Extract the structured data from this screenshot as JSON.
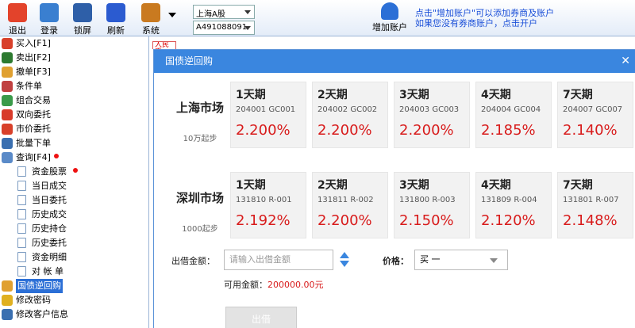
{
  "toolbar": {
    "buttons": [
      {
        "label": "退出",
        "icon": "power-icon",
        "color": "#e3432b"
      },
      {
        "label": "登录",
        "icon": "users-icon",
        "color": "#3a7fd0"
      },
      {
        "label": "锁屏",
        "icon": "grid-lock-icon",
        "color": "#2e5fa8"
      },
      {
        "label": "刷新",
        "icon": "refresh-icon",
        "color": "#2b5bd0"
      },
      {
        "label": "系统",
        "icon": "tools-icon",
        "color": "#c97a20"
      }
    ],
    "market_select": "上海A股",
    "account_select": "A491088091",
    "add_account_label": "增加账户",
    "tip_line1": "点击\"增加账户\"可以添加券商及账户",
    "tip_line2": "如果您没有券商账户，点击开户"
  },
  "sidebar": {
    "items": [
      {
        "label": "买入[F1]",
        "icon": "buy-icon",
        "color": "#d8402a",
        "sub": false
      },
      {
        "label": "卖出[F2]",
        "icon": "sell-icon",
        "color": "#2d7a30",
        "sub": false
      },
      {
        "label": "撤单[F3]",
        "icon": "cancel-hand-icon",
        "color": "#e0a030",
        "sub": false
      },
      {
        "label": "条件单",
        "icon": "condition-icon",
        "color": "#c04040",
        "sub": false
      },
      {
        "label": "组合交易",
        "icon": "globe-icon",
        "color": "#3a9a4a",
        "sub": false
      },
      {
        "label": "双向委托",
        "icon": "two-way-icon",
        "color": "#d83a2a",
        "sub": false
      },
      {
        "label": "市价委托",
        "icon": "market-icon",
        "color": "#d8402a",
        "sub": false
      },
      {
        "label": "批量下单",
        "icon": "batch-icon",
        "color": "#3a6fb0",
        "sub": false
      },
      {
        "label": "查询[F4]",
        "icon": "query-icon",
        "color": "#5a8ac8",
        "sub": false,
        "dot": true
      },
      {
        "label": "资金股票",
        "icon": "doc-icon",
        "sub": true,
        "dot": true
      },
      {
        "label": "当日成交",
        "icon": "doc-icon",
        "sub": true
      },
      {
        "label": "当日委托",
        "icon": "doc-icon",
        "sub": true
      },
      {
        "label": "历史成交",
        "icon": "doc-icon",
        "sub": true
      },
      {
        "label": "历史持仓",
        "icon": "doc-icon",
        "sub": true
      },
      {
        "label": "历史委托",
        "icon": "doc-icon",
        "sub": true
      },
      {
        "label": "资金明细",
        "icon": "doc-icon",
        "sub": true
      },
      {
        "label": "对 帐 单",
        "icon": "doc-icon",
        "sub": true
      },
      {
        "label": "国债逆回购",
        "icon": "bond-icon",
        "color": "#e0a030",
        "sub": false,
        "active": true
      },
      {
        "label": "修改密码",
        "icon": "key-icon",
        "color": "#e0b020",
        "sub": false
      },
      {
        "label": "修改客户信息",
        "icon": "user-edit-icon",
        "color": "#3a6fb0",
        "sub": false
      }
    ]
  },
  "main": {
    "tab_stub": "人民币",
    "dialog_title": "国债逆回购",
    "markets": [
      {
        "name": "上海市场",
        "min": "10万起步",
        "products": [
          {
            "term": "1天期",
            "code": "204001 GC001",
            "rate": "2.200%"
          },
          {
            "term": "2天期",
            "code": "204002 GC002",
            "rate": "2.200%"
          },
          {
            "term": "3天期",
            "code": "204003 GC003",
            "rate": "2.200%"
          },
          {
            "term": "4天期",
            "code": "204004 GC004",
            "rate": "2.185%"
          },
          {
            "term": "7天期",
            "code": "204007 GC007",
            "rate": "2.140%"
          }
        ]
      },
      {
        "name": "深圳市场",
        "min": "1000起步",
        "products": [
          {
            "term": "1天期",
            "code": "131810 R-001",
            "rate": "2.192%"
          },
          {
            "term": "2天期",
            "code": "131811 R-002",
            "rate": "2.200%"
          },
          {
            "term": "3天期",
            "code": "131800 R-003",
            "rate": "2.150%"
          },
          {
            "term": "4天期",
            "code": "131809 R-004",
            "rate": "2.120%"
          },
          {
            "term": "7天期",
            "code": "131801 R-007",
            "rate": "2.148%"
          }
        ]
      }
    ],
    "form": {
      "amount_label": "出借金额：",
      "amount_placeholder": "请输入出借金额",
      "price_label": "价格：",
      "price_value": "买 一",
      "available_label": "可用金额：",
      "available_value": "200000.00元",
      "submit_label": "出借"
    }
  }
}
